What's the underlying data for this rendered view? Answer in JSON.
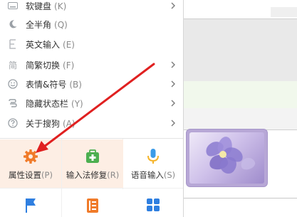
{
  "menu": {
    "items": [
      {
        "icon": "keyboard-icon",
        "label": "软键盘",
        "key": "(K)",
        "has_submenu": true
      },
      {
        "icon": "moon-icon",
        "label": "全半角",
        "key": "(Q)",
        "has_submenu": false
      },
      {
        "icon": "letter-e-icon",
        "label": "英文输入",
        "key": "(E)",
        "has_submenu": false
      },
      {
        "icon": "simplified-traditional-icon",
        "icon_text": "简",
        "label": "简繁切换",
        "key": "(F)",
        "has_submenu": true
      },
      {
        "icon": "smiley-icon",
        "label": "表情&符号",
        "key": "(B)",
        "has_submenu": true
      },
      {
        "icon": "hide-toolbar-icon",
        "label": "隐藏状态栏",
        "key": "(Y)",
        "has_submenu": true
      },
      {
        "icon": "help-icon",
        "label": "关于搜狗",
        "key": "(A)",
        "has_submenu": true
      }
    ],
    "tiles": [
      {
        "icon": "gear-icon",
        "label": "属性设置",
        "key": "(P)",
        "color": "#f07b2a",
        "highlight": true
      },
      {
        "icon": "toolbox-repair-icon",
        "label": "输入法修复",
        "key": "(R)",
        "color": "#4caf50",
        "highlight": true
      },
      {
        "icon": "microphone-icon",
        "label": "语音输入",
        "key": "(S)",
        "color": "#3b9be8",
        "highlight": false
      },
      {
        "icon": "flag-icon",
        "label": "",
        "key": "",
        "color": "#2f7fe0",
        "highlight": false
      },
      {
        "icon": "notes-icon",
        "label": "",
        "key": "",
        "color": "#f07b2a",
        "highlight": false
      },
      {
        "icon": "grid-apps-icon",
        "label": "",
        "key": "",
        "color": "#2f7fe0",
        "highlight": false
      }
    ]
  },
  "colors": {
    "accent_orange": "#f07b2a",
    "annotation_red": "#e02020",
    "tile_highlight": "#fdeee4"
  }
}
